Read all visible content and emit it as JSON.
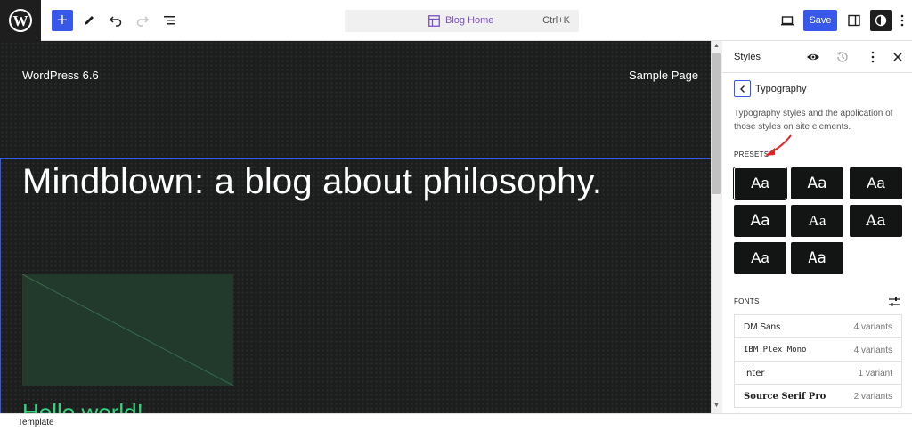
{
  "topbar": {
    "logo_letter": "W",
    "command_bar": {
      "title": "Blog Home",
      "shortcut": "Ctrl+K"
    },
    "save_label": "Save"
  },
  "canvas": {
    "site_title": "WordPress 6.6",
    "nav_link": "Sample Page",
    "headline": "Mindblown: a blog about philosophy.",
    "post_title": "Hello world!"
  },
  "sidebar": {
    "title": "Styles",
    "panel_title": "Typography",
    "description": "Typography styles and the application of those styles on site elements.",
    "presets_label": "PRESETS",
    "presets": [
      "Aa",
      "Aa",
      "Aa",
      "Aa",
      "Aa",
      "Aa",
      "Aa",
      "Aa"
    ],
    "selected_preset_index": 0,
    "fonts_label": "FONTS",
    "fonts": [
      {
        "name": "DM Sans",
        "variants": "4 variants"
      },
      {
        "name": "IBM Plex Mono",
        "variants": "4 variants"
      },
      {
        "name": "Inter",
        "variants": "1 variant"
      },
      {
        "name": "Source Serif Pro",
        "variants": "2 variants"
      }
    ]
  },
  "footer": {
    "breadcrumb": "Template"
  },
  "colors": {
    "accent": "#3858e9",
    "canvas_bg": "#1b1e1c",
    "post_title": "#35d37e",
    "annotation_arrow": "#e0262b"
  },
  "icons": {
    "add": "plus-icon",
    "tools": "pen-icon",
    "undo": "undo-icon",
    "redo": "redo-icon",
    "list_view": "list-view-icon",
    "template": "layout-icon",
    "preview": "desktop-icon",
    "settings": "sidebar-icon",
    "styles": "half-circle-icon",
    "options": "kebab-icon",
    "style_book": "eye-icon",
    "revisions": "history-icon",
    "close": "close-icon",
    "back": "chevron-left-icon",
    "font_manage": "sliders-icon"
  }
}
